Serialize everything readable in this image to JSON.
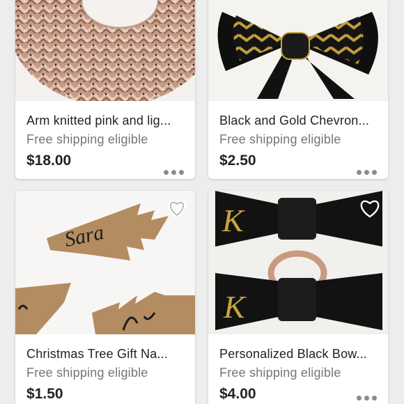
{
  "listings": [
    {
      "title": "Arm knitted pink and lig...",
      "shipping": "Free shipping eligible",
      "price": "$18.00",
      "image": "pink knitted scarf photo"
    },
    {
      "title": "Black and Gold Chevron...",
      "shipping": "Free shipping eligible",
      "price": "$2.50",
      "image": "black and gold chevron hair bow photo"
    },
    {
      "title": "Christmas Tree Gift Na...",
      "shipping": "Free shipping eligible",
      "price": "$1.50",
      "image_text": "Sara",
      "favorite_icon": "heart-outline-icon"
    },
    {
      "title": "Personalized Black Bow...",
      "shipping": "Free shipping eligible",
      "price": "$4.00",
      "image_text": "K",
      "favorite_icon": "heart-outline-icon"
    }
  ],
  "more_icon": "more-horizontal-icon",
  "colors": {
    "background": "#ededed",
    "card": "#ffffff",
    "text_primary": "#222222",
    "text_secondary": "#757575"
  }
}
